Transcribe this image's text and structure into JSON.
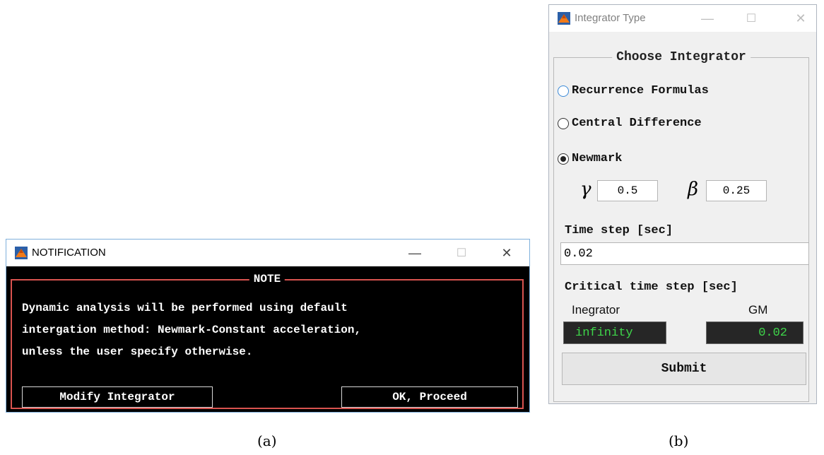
{
  "notification_window": {
    "title": "NOTIFICATION",
    "frame_title": "NOTE",
    "message": "Dynamic analysis will be performed using default\nintergation method: Newmark-Constant acceleration,\nunless the user specify otherwise.",
    "buttons": {
      "modify": "Modify Integrator",
      "ok": "OK, Proceed"
    },
    "controls": {
      "minimize": "—",
      "maximize": "☐",
      "close": "✕"
    }
  },
  "integrator_window": {
    "title": "Integrator Type",
    "frame_title": "Choose Integrator",
    "options": [
      {
        "label": "Recurrence Formulas",
        "selected": false
      },
      {
        "label": "Central Difference",
        "selected": false
      },
      {
        "label": "Newmark",
        "selected": true
      }
    ],
    "newmark_params": {
      "gamma_symbol": "γ",
      "gamma_value": "0.5",
      "beta_symbol": "β",
      "beta_value": "0.25"
    },
    "time_step_label": "Time step [sec]",
    "time_step_value": "0.02",
    "critical_label": "Critical time step [sec]",
    "integrator_label": "Inegrator",
    "gm_label": "GM",
    "integrator_critical": "infinity",
    "gm_critical": "0.02",
    "submit_label": "Submit",
    "controls": {
      "minimize": "—",
      "maximize": "☐",
      "close": "✕"
    }
  },
  "captions": {
    "a": "(a)",
    "b": "(b)"
  },
  "colors": {
    "note_border": "#d9534f",
    "green_text": "#3ed64a",
    "focus_blue": "#3c8ad8"
  },
  "icons": {
    "app": "matlab-icon"
  }
}
